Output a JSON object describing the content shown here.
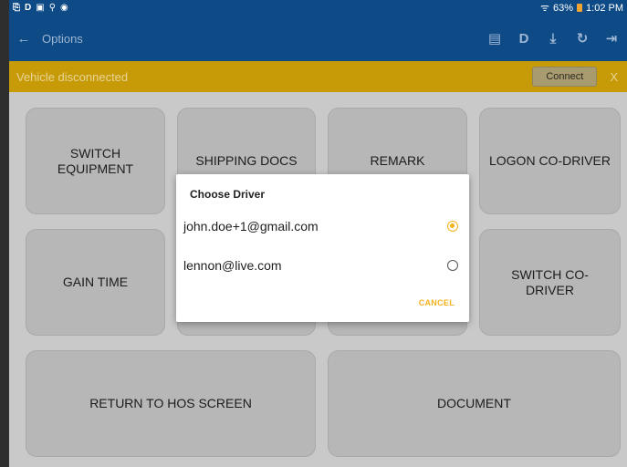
{
  "statusbar": {
    "left_icons": [
      "screenshot-icon",
      "d-icon",
      "gallery-icon",
      "usb-icon",
      "app-icon"
    ],
    "wifi": "wifi-icon",
    "battery_text": "63%",
    "time": "1:02 PM"
  },
  "appbar": {
    "title": "Options",
    "actions": [
      "document-icon",
      "d-icon",
      "download-icon",
      "refresh-icon",
      "logout-icon"
    ]
  },
  "vehicle_bar": {
    "message": "Vehicle disconnected",
    "connect_label": "Connect",
    "close_label": "X"
  },
  "tiles": {
    "switch_equipment": "SWITCH EQUIPMENT",
    "shipping_docs": "SHIPPING DOCS",
    "remark": "REMARK",
    "logon_codriver": "LOGON CO-DRIVER",
    "gain_time": "GAIN TIME",
    "switch_codriver": "SWITCH CO-DRIVER",
    "return_hos": "RETURN TO HOS SCREEN",
    "document": "DOCUMENT"
  },
  "dialog": {
    "title": "Choose Driver",
    "options": [
      {
        "label": "john.doe+1@gmail.com",
        "selected": true
      },
      {
        "label": "lennon@live.com",
        "selected": false
      }
    ],
    "cancel_label": "CANCEL"
  },
  "colors": {
    "appbar": "#0d4a86",
    "vehicle_bar": "#c79b08",
    "accent": "#f3b21b"
  }
}
